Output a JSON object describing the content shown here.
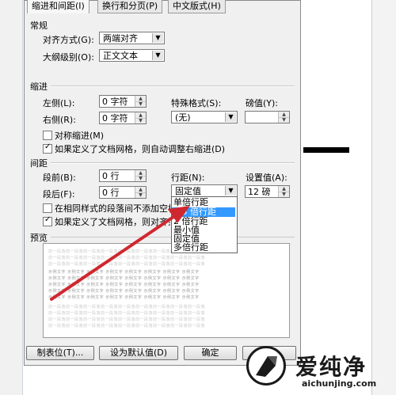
{
  "tabs": [
    "缩进和间距(I)",
    "换行和分页(P)",
    "中文版式(H)"
  ],
  "general": {
    "title": "常规",
    "alignment_label": "对齐方式(G):",
    "alignment_value": "两端对齐",
    "outline_label": "大纲级别(O):",
    "outline_value": "正文文本"
  },
  "indent": {
    "title": "缩进",
    "left_label": "左侧(L):",
    "left_value": "0 字符",
    "right_label": "右侧(R):",
    "right_value": "0 字符",
    "special_label": "特殊格式(S):",
    "special_value": "(无)",
    "by_label": "磅值(Y):",
    "by_value": "",
    "mirror_label": "对称缩进(M)",
    "auto_right_label": "如果定义了文档网格，则自动调整右缩进(D)"
  },
  "spacing": {
    "title": "间距",
    "before_label": "段前(B):",
    "before_value": "0 行",
    "after_label": "段后(F):",
    "after_value": "0 行",
    "line_label": "行距(N):",
    "line_value": "固定值",
    "at_label": "设置值(A):",
    "at_value": "12 磅",
    "no_space_label": "在相同样式的段落间不添加空格",
    "snap_grid_label": "如果定义了文档网格，则对齐到网格"
  },
  "line_spacing_options": [
    "单倍行距",
    "1.5 倍行距",
    "2 倍行距",
    "最小值",
    "固定值",
    "多倍行距"
  ],
  "preview": {
    "title": "预览",
    "sample_light": "前一段落前一段落前一段落前一段落前一段落前一段落前一段落前一段落前一段落",
    "sample_dark": "示例文字 示例文字 示例文字 示例文字 示例文字 示例文字 示例文字 示例文字"
  },
  "buttons": {
    "tabs": "制表位(T)...",
    "default": "设为默认值(D)",
    "ok": "确定"
  },
  "watermark": {
    "brand": "爱纯净",
    "url": "aichunjing.com"
  },
  "colors": {
    "selection": "#3399ff",
    "arrow": "#d0272f"
  }
}
